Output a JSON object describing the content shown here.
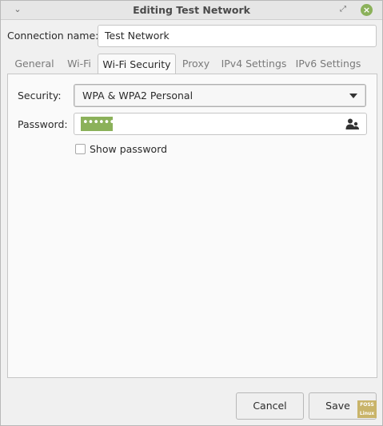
{
  "window": {
    "title": "Editing Test Network"
  },
  "connection": {
    "label": "Connection name:",
    "value": "Test Network"
  },
  "tabs": [
    {
      "label": "General"
    },
    {
      "label": "Wi-Fi"
    },
    {
      "label": "Wi-Fi Security"
    },
    {
      "label": "Proxy"
    },
    {
      "label": "IPv4 Settings"
    },
    {
      "label": "IPv6 Settings"
    }
  ],
  "security": {
    "label": "Security:",
    "selected": "WPA & WPA2 Personal"
  },
  "password": {
    "label": "Password:",
    "masked_value": "••••••••",
    "icon": "user-password-icon"
  },
  "show_password": {
    "label": "Show password",
    "checked": false
  },
  "buttons": {
    "cancel": "Cancel",
    "save": "Save"
  },
  "watermark": {
    "line1": "FOSS",
    "line2": "Linux"
  },
  "colors": {
    "accent": "#8bb15a"
  }
}
